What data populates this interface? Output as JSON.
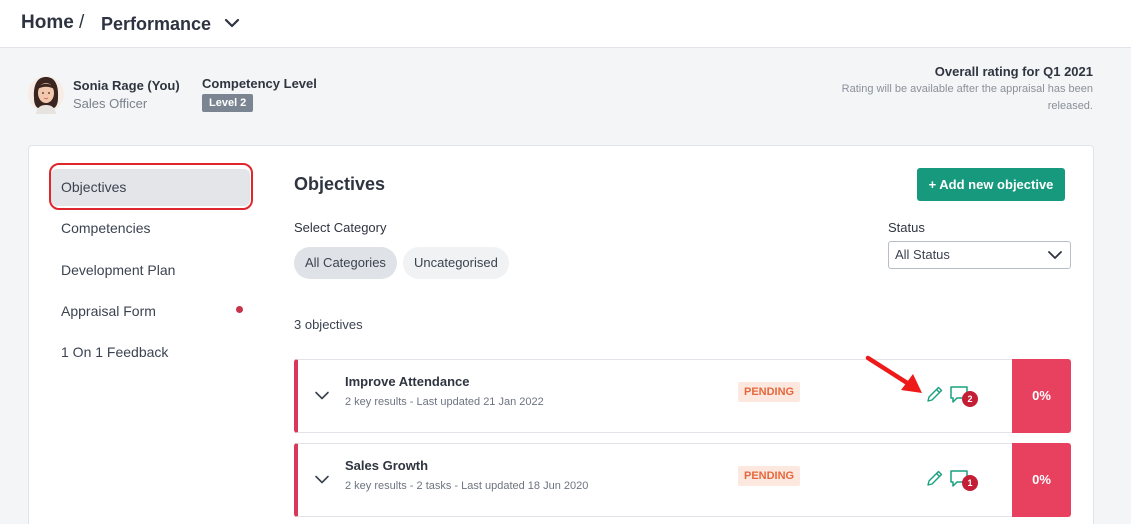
{
  "breadcrumb": {
    "home": "Home",
    "separator": "/",
    "current": "Performance",
    "dropdown_icon": "chevron-down-icon"
  },
  "profile": {
    "name": "Sonia Rage (You)",
    "role": "Sales Officer",
    "competency_label": "Competency Level",
    "competency_value": "Level 2",
    "rating_title": "Overall rating for Q1 2021",
    "rating_note": "Rating will be available after the appraisal has been released."
  },
  "sidebar": {
    "items": [
      {
        "label": "Objectives",
        "active": true
      },
      {
        "label": "Competencies"
      },
      {
        "label": "Development Plan"
      },
      {
        "label": "Appraisal Form",
        "notification_dot": true
      },
      {
        "label": "1 On 1 Feedback"
      }
    ]
  },
  "main": {
    "title": "Objectives",
    "add_button": "+ Add new objective",
    "category_label": "Select Category",
    "categories": [
      {
        "label": "All Categories",
        "active": true
      },
      {
        "label": "Uncategorised"
      }
    ],
    "status_label": "Status",
    "status_value": "All Status",
    "count_text": "3 objectives",
    "objectives": [
      {
        "title": "Improve Attendance",
        "meta": "2 key results - Last updated 21 Jan 2022",
        "status": "PENDING",
        "comments": "2",
        "score": "0%"
      },
      {
        "title": "Sales Growth",
        "meta": "2 key results - 2 tasks - Last updated 18 Jun 2020",
        "status": "PENDING",
        "comments": "1",
        "score": "0%"
      }
    ]
  },
  "colors": {
    "accent": "#16997c",
    "danger": "#e8415f",
    "row_border": "#d8385a",
    "highlight": "#e0262d",
    "pending_text": "#e5683d"
  }
}
